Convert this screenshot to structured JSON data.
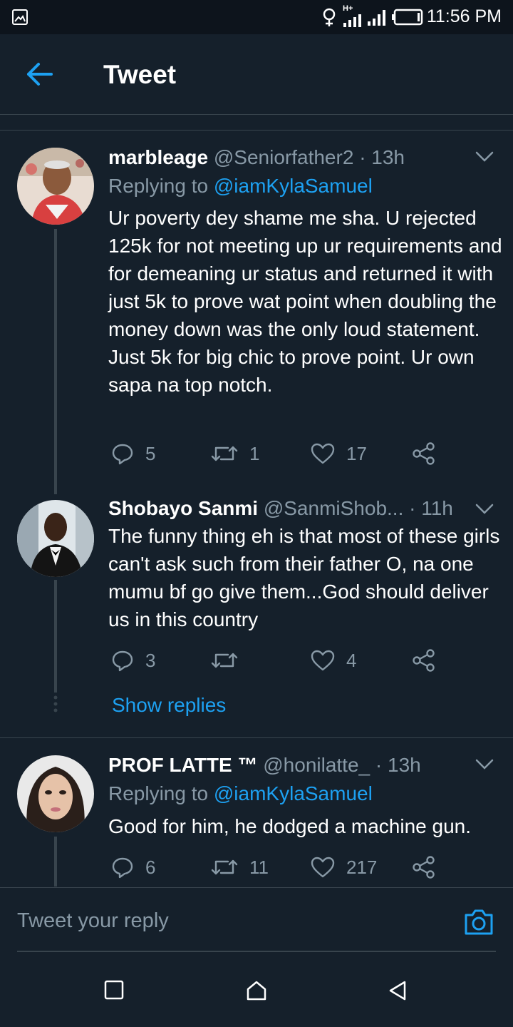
{
  "status_bar": {
    "time": "11:56 PM",
    "signal_label": "H+"
  },
  "header": {
    "title": "Tweet"
  },
  "tweets": [
    {
      "display_name": "marbleage",
      "handle": "@Seniorfather2",
      "time": "· 13h",
      "replying_label": "Replying to",
      "replying_to": "@iamKylaSamuel",
      "text": "Ur poverty dey shame me sha. U rejected 125k for not meeting up ur requirements and for demeaning ur status and returned it with just 5k to prove wat point when doubling the money down was the only loud statement. Just 5k for big chic to prove point. Ur own sapa na top notch.",
      "replies": "5",
      "retweets": "1",
      "likes": "17"
    },
    {
      "display_name": "Shobayo Sanmi",
      "handle": "@SanmiShob...",
      "time": "· 11h",
      "text": "The funny thing eh is that most of these girls can't ask such from their father O, na one mumu bf go give them...God should deliver us in this country",
      "replies": "3",
      "retweets": "",
      "likes": "4"
    },
    {
      "display_name": "PROF LATTE ™",
      "handle": "@honilatte_",
      "time": "· 13h",
      "replying_label": "Replying to",
      "replying_to": "@iamKylaSamuel",
      "text": "Good for him, he dodged a machine gun.",
      "replies": "6",
      "retweets": "11",
      "likes": "217"
    }
  ],
  "show_replies": "Show replies",
  "reply_box": {
    "placeholder": "Tweet your reply"
  },
  "icons": {
    "back": "back-arrow-icon",
    "chevron": "chevron-down-icon",
    "reply": "reply-icon",
    "retweet": "retweet-icon",
    "like": "heart-icon",
    "share": "share-icon",
    "camera": "camera-icon"
  },
  "colors": {
    "background": "#15202b",
    "accent": "#1da1f2",
    "secondary_text": "#8899a6",
    "divider": "#38444d"
  }
}
